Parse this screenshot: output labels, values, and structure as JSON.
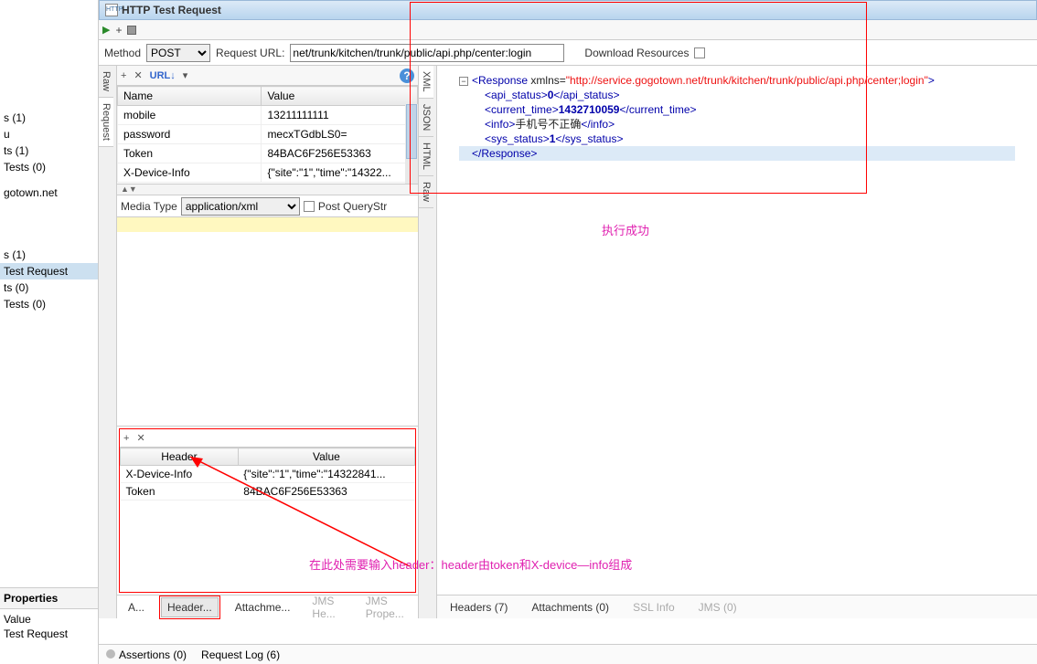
{
  "window": {
    "title": "HTTP Test Request",
    "icon_label": "HTTP"
  },
  "left_tree": {
    "items": [
      {
        "label": "s (1)"
      },
      {
        "label": "u"
      },
      {
        "label": "ts (1)"
      },
      {
        "label": "Tests (0)"
      },
      {
        "label": ""
      },
      {
        "label": "gotown.net"
      },
      {
        "label": ""
      },
      {
        "label": ""
      },
      {
        "label": "s (1)"
      },
      {
        "label": "Test Request",
        "selected": true
      },
      {
        "label": "ts (0)"
      },
      {
        "label": "Tests (0)"
      }
    ],
    "properties_header": "Properties",
    "prop_value_label": "Value",
    "prop_row_label": "Test Request"
  },
  "toolbar": {
    "method_label": "Method",
    "method_value": "POST",
    "url_label": "Request URL:",
    "url_value": "net/trunk/kitchen/trunk/public/api.php/center:login",
    "download_label": "Download Resources"
  },
  "req_vtabs": {
    "a": "Raw",
    "b": "Request"
  },
  "params": {
    "col_name": "Name",
    "col_value": "Value",
    "rows": [
      {
        "name": "mobile",
        "value": "13211111111"
      },
      {
        "name": "password",
        "value": "mecxTGdbLS0="
      },
      {
        "name": "Token",
        "value": "84BAC6F256E53363"
      },
      {
        "name": "X-Device-Info",
        "value": "{\"site\":\"1\",\"time\":\"14322..."
      }
    ],
    "expand": "▲▼"
  },
  "media": {
    "label": "Media Type",
    "value": "application/xml",
    "post_query": "Post QueryStr"
  },
  "headers": {
    "col_h": "Header",
    "col_v": "Value",
    "rows": [
      {
        "h": "X-Device-Info",
        "v": "{\"site\":\"1\",\"time\":\"14322841..."
      },
      {
        "h": "Token",
        "v": "84BAC6F256E53363"
      }
    ]
  },
  "bottom_tabs": {
    "a": "A...",
    "b": "Header...",
    "c": "Attachme...",
    "d": "JMS He...",
    "e": "JMS Prope..."
  },
  "status": {
    "assertions": "Assertions (0)",
    "reqlog": "Request Log (6)"
  },
  "resp_vtabs": {
    "a": "XML",
    "b": "JSON",
    "c": "HTML",
    "d": "Raw"
  },
  "response": {
    "l1a": "Response",
    "l1b": "xmlns=",
    "l1c": "\"http://service.gogotown.net/trunk/kitchen/trunk/public/api.php/center;login\"",
    "l2a": "api_status",
    "l2v": "0",
    "l2c": "/api_status",
    "l3a": "current_time",
    "l3v": "1432710059",
    "l3c": "/current_time",
    "l4a": "info",
    "l4v": "手机号不正确",
    "l4c": "/info",
    "l5a": "sys_status",
    "l5v": "1",
    "l5c": "/sys_status",
    "l6": "/Response"
  },
  "resp_tabs": {
    "a": "Headers (7)",
    "b": "Attachments (0)",
    "c": "SSL Info",
    "d": "JMS (0)"
  },
  "annotations": {
    "success": "执行成功",
    "header_note": "在此处需要输入header：header由token和X-device—info组成"
  }
}
